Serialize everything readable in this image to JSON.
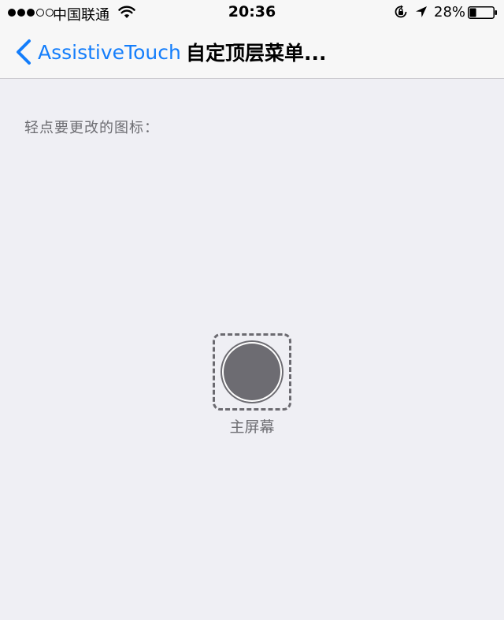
{
  "status_bar": {
    "carrier": "中国联通",
    "time": "20:36",
    "battery_percent": "28%",
    "battery_level": 0.28,
    "signal_strength": 3,
    "signal_max": 5
  },
  "nav_bar": {
    "back_label": "AssistiveTouch",
    "title": "自定顶层菜单..."
  },
  "content": {
    "instruction": "轻点要更改的图标：",
    "icon": {
      "label": "主屏幕",
      "icon_name": "home-button-icon"
    }
  },
  "colors": {
    "accent": "#147efb",
    "background": "#efeff4",
    "icon_gray": "#6d6c72"
  }
}
